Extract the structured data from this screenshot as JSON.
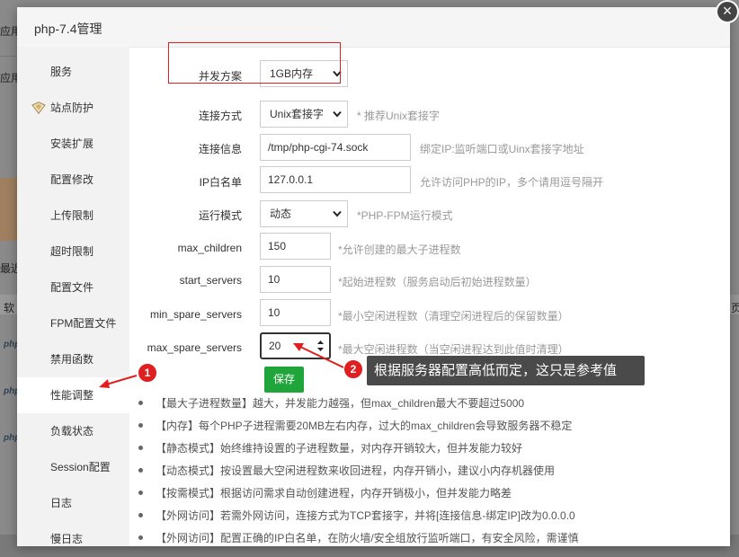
{
  "background": {
    "texts": [
      "应用",
      "应用",
      "最近",
      "软",
      "php",
      "php",
      "php",
      "页"
    ]
  },
  "modal": {
    "title": "php-7.4管理",
    "close_symbol": "×"
  },
  "sidebar": {
    "items": [
      {
        "label": "服务"
      },
      {
        "label": "站点防护",
        "icon": "shield-icon"
      },
      {
        "label": "安装扩展"
      },
      {
        "label": "配置修改"
      },
      {
        "label": "上传限制"
      },
      {
        "label": "超时限制"
      },
      {
        "label": "配置文件"
      },
      {
        "label": "FPM配置文件"
      },
      {
        "label": "禁用函数"
      },
      {
        "label": "性能调整"
      },
      {
        "label": "负载状态"
      },
      {
        "label": "Session配置"
      },
      {
        "label": "日志"
      },
      {
        "label": "慢日志"
      }
    ],
    "active_index": 9
  },
  "form": {
    "concurrency": {
      "label": "并发方案",
      "value": "1GB内存"
    },
    "connection_type": {
      "label": "连接方式",
      "value": "Unix套接字",
      "hint": "* 推荐Unix套接字"
    },
    "connection_info": {
      "label": "连接信息",
      "value": "/tmp/php-cgi-74.sock",
      "hint": "绑定IP:监听端口或Uinx套接字地址"
    },
    "ip_whitelist": {
      "label": "IP白名单",
      "value": "127.0.0.1",
      "hint": "允许访问PHP的IP，多个请用逗号隔开"
    },
    "run_mode": {
      "label": "运行模式",
      "value": "动态",
      "hint": "*PHP-FPM运行模式"
    },
    "max_children": {
      "label": "max_children",
      "value": "150",
      "hint": "*允许创建的最大子进程数"
    },
    "start_servers": {
      "label": "start_servers",
      "value": "10",
      "hint": "*起始进程数（服务启动后初始进程数量）"
    },
    "min_spare_servers": {
      "label": "min_spare_servers",
      "value": "10",
      "hint": "*最小空闲进程数（清理空闲进程后的保留数量）"
    },
    "max_spare_servers": {
      "label": "max_spare_servers",
      "value": "20",
      "hint": "*最大空闲进程数（当空闲进程达到此值时清理）"
    },
    "save_label": "保存"
  },
  "notes": [
    "【最大子进程数量】越大，并发能力越强，但max_children最大不要超过5000",
    "【内存】每个PHP子进程需要20MB左右内存，过大的max_children会导致服务器不稳定",
    "【静态模式】始终维持设置的子进程数量，对内存开销较大，但并发能力较好",
    "【动态模式】按设置最大空闲进程数来收回进程，内存开销小，建议小内存机器使用",
    "【按需模式】根据访问需求自动创建进程，内存开销极小，但并发能力略差",
    "【外网访问】若需外网访问，连接方式为TCP套接字，并将[连接信息-绑定IP]改为0.0.0.0",
    "【外网访问】配置正确的IP白名单，在防火墙/安全组放行监听端口，有安全风险，需谨慎"
  ],
  "annotations": {
    "badge1": "1",
    "badge2": "2",
    "tooltip": "根据服务器配置高低而定，这只是参考值",
    "accent_color": "#e02020",
    "save_color": "#20a53a"
  }
}
